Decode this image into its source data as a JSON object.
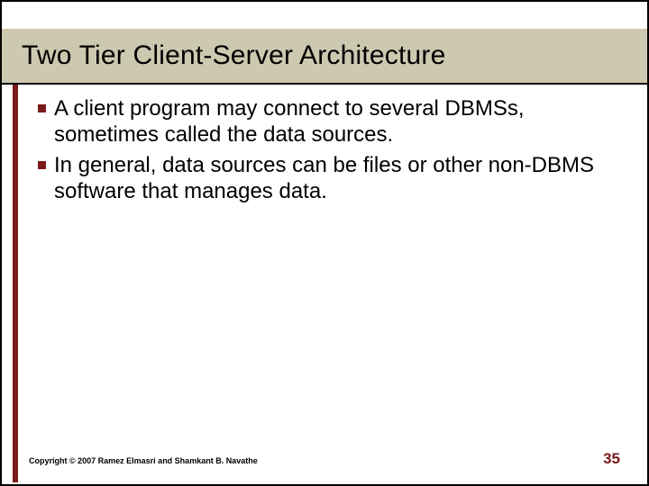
{
  "title": "Two Tier Client-Server Architecture",
  "bullets": [
    "A client program may connect to several DBMSs, sometimes called the data sources.",
    "In general, data sources can be files or other non-DBMS software that manages data."
  ],
  "copyright": "Copyright © 2007 Ramez Elmasri and Shamkant B. Navathe",
  "pageNumber": "35"
}
